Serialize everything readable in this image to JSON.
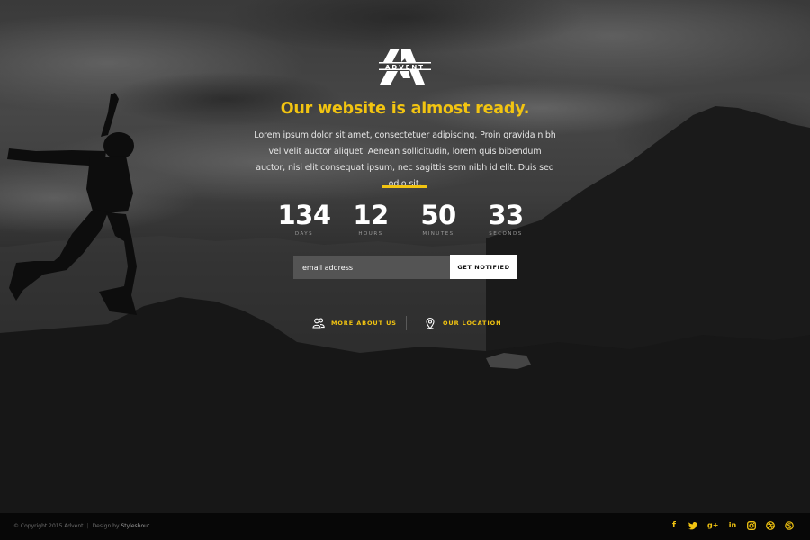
{
  "brand": {
    "logo_text": "ADVENT"
  },
  "headline": "Our website is almost ready.",
  "intro": "Lorem ipsum dolor sit amet, consectetuer adipiscing. Proin gravida nibh vel velit auctor aliquet. Aenean sollicitudin, lorem quis bibendum auctor, nisi elit consequat ipsum, nec sagittis sem nibh id elit. Duis sed odio sit.",
  "countdown": [
    {
      "value": "134",
      "label": "DAYS"
    },
    {
      "value": "12",
      "label": "HOURS"
    },
    {
      "value": "50",
      "label": "MINUTES"
    },
    {
      "value": "33",
      "label": "SECONDS"
    }
  ],
  "subscribe": {
    "placeholder": "email address",
    "button_label": "GET NOTIFIED"
  },
  "links": {
    "about": {
      "label": "MORE ABOUT US",
      "icon": "people-icon"
    },
    "location": {
      "label": "OUR LOCATION",
      "icon": "map-pin-icon"
    }
  },
  "footer": {
    "copyright": "© Copyright 2015 Advent",
    "design_prefix": "Design by",
    "design_brand": "Styleshout",
    "social": [
      "facebook-icon",
      "twitter-icon",
      "google-plus-icon",
      "linkedin-icon",
      "instagram-icon",
      "dribbble-icon",
      "skype-icon"
    ]
  },
  "colors": {
    "accent": "#f2c411",
    "footer_bg": "#070707",
    "button_bg": "#ffffff"
  }
}
